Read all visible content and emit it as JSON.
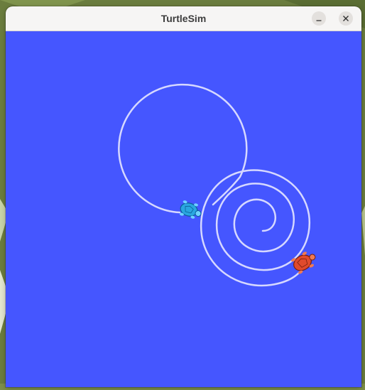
{
  "window": {
    "title": "TurtleSim",
    "controls": [
      {
        "id": "minimize",
        "icon": "minimize-icon"
      },
      {
        "id": "close",
        "icon": "close-icon"
      }
    ]
  },
  "canvas": {
    "background_color": "#4556ff",
    "trail_color": "#d6d8ff",
    "turtles": [
      {
        "name": "turtle-blue",
        "color": "#2aa6e0"
      },
      {
        "name": "turtle-red",
        "color": "#e04a2c"
      }
    ]
  },
  "desktop": {
    "wallpaper_color": "#6a7f3c"
  }
}
